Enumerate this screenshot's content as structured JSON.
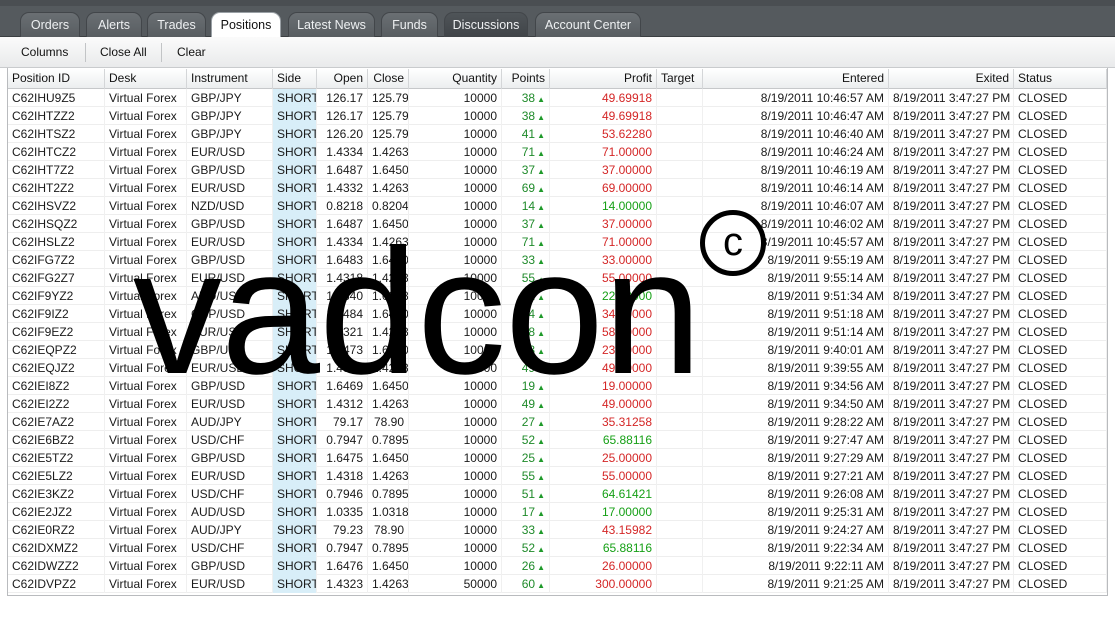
{
  "tabs": [
    {
      "label": "Orders"
    },
    {
      "label": "Alerts"
    },
    {
      "label": "Trades"
    },
    {
      "label": "Positions"
    },
    {
      "label": "Latest News"
    },
    {
      "label": "Funds"
    },
    {
      "label": "Discussions"
    },
    {
      "label": "Account Center"
    }
  ],
  "toolbar": {
    "columns": "Columns",
    "close_all": "Close All",
    "clear": "Clear"
  },
  "columns": [
    "Position ID",
    "Desk",
    "Instrument",
    "Side",
    "Open",
    "Close",
    "Quantity",
    "Points",
    "Profit",
    "Target",
    "Entered",
    "Exited",
    "Status"
  ],
  "rows": [
    [
      "C62IHU9Z5",
      "Virtual Forex",
      "GBP/JPY",
      "SHORT",
      "126.17",
      "125.79",
      "10000",
      "38",
      "49.69918",
      "",
      "8/19/2011 10:46:57 AM",
      "8/19/2011 3:47:27 PM",
      "CLOSED"
    ],
    [
      "C62IHTZZ2",
      "Virtual Forex",
      "GBP/JPY",
      "SHORT",
      "126.17",
      "125.79",
      "10000",
      "38",
      "49.69918",
      "",
      "8/19/2011 10:46:47 AM",
      "8/19/2011 3:47:27 PM",
      "CLOSED"
    ],
    [
      "C62IHTSZ2",
      "Virtual Forex",
      "GBP/JPY",
      "SHORT",
      "126.20",
      "125.79",
      "10000",
      "41",
      "53.62280",
      "",
      "8/19/2011 10:46:40 AM",
      "8/19/2011 3:47:27 PM",
      "CLOSED"
    ],
    [
      "C62IHTCZ2",
      "Virtual Forex",
      "EUR/USD",
      "SHORT",
      "1.4334",
      "1.4263",
      "10000",
      "71",
      "71.00000",
      "",
      "8/19/2011 10:46:24 AM",
      "8/19/2011 3:47:27 PM",
      "CLOSED"
    ],
    [
      "C62IHT7Z2",
      "Virtual Forex",
      "GBP/USD",
      "SHORT",
      "1.6487",
      "1.6450",
      "10000",
      "37",
      "37.00000",
      "",
      "8/19/2011 10:46:19 AM",
      "8/19/2011 3:47:27 PM",
      "CLOSED"
    ],
    [
      "C62IHT2Z2",
      "Virtual Forex",
      "EUR/USD",
      "SHORT",
      "1.4332",
      "1.4263",
      "10000",
      "69",
      "69.00000",
      "",
      "8/19/2011 10:46:14 AM",
      "8/19/2011 3:47:27 PM",
      "CLOSED"
    ],
    [
      "C62IHSVZ2",
      "Virtual Forex",
      "NZD/USD",
      "SHORT",
      "0.8218",
      "0.8204",
      "10000",
      "14",
      "14.00000",
      "",
      "8/19/2011 10:46:07 AM",
      "8/19/2011 3:47:27 PM",
      "CLOSED"
    ],
    [
      "C62IHSQZ2",
      "Virtual Forex",
      "GBP/USD",
      "SHORT",
      "1.6487",
      "1.6450",
      "10000",
      "37",
      "37.00000",
      "",
      "8/19/2011 10:46:02 AM",
      "8/19/2011 3:47:27 PM",
      "CLOSED"
    ],
    [
      "C62IHSLZ2",
      "Virtual Forex",
      "EUR/USD",
      "SHORT",
      "1.4334",
      "1.4263",
      "10000",
      "71",
      "71.00000",
      "",
      "8/19/2011 10:45:57 AM",
      "8/19/2011 3:47:27 PM",
      "CLOSED"
    ],
    [
      "C62IFG7Z2",
      "Virtual Forex",
      "GBP/USD",
      "SHORT",
      "1.6483",
      "1.6450",
      "10000",
      "33",
      "33.00000",
      "",
      "8/19/2011 9:55:19 AM",
      "8/19/2011 3:47:27 PM",
      "CLOSED"
    ],
    [
      "C62IFG2Z7",
      "Virtual Forex",
      "EUR/USD",
      "SHORT",
      "1.4318",
      "1.4263",
      "10000",
      "55",
      "55.00000",
      "",
      "8/19/2011 9:55:14 AM",
      "8/19/2011 3:47:27 PM",
      "CLOSED"
    ],
    [
      "C62IF9YZ2",
      "Virtual Forex",
      "AUD/USD",
      "SHORT",
      "1.0340",
      "1.0318",
      "10000",
      "22",
      "22.00000",
      "",
      "8/19/2011 9:51:34 AM",
      "8/19/2011 3:47:27 PM",
      "CLOSED"
    ],
    [
      "C62IF9IZ2",
      "Virtual Forex",
      "GBP/USD",
      "SHORT",
      "1.6484",
      "1.6450",
      "10000",
      "34",
      "34.00000",
      "",
      "8/19/2011 9:51:18 AM",
      "8/19/2011 3:47:27 PM",
      "CLOSED"
    ],
    [
      "C62IF9EZ2",
      "Virtual Forex",
      "EUR/USD",
      "SHORT",
      "1.4321",
      "1.4263",
      "10000",
      "58",
      "58.00000",
      "",
      "8/19/2011 9:51:14 AM",
      "8/19/2011 3:47:27 PM",
      "CLOSED"
    ],
    [
      "C62IEQPZ2",
      "Virtual Forex",
      "GBP/USD",
      "SHORT",
      "1.6473",
      "1.6450",
      "10000",
      "23",
      "23.00000",
      "",
      "8/19/2011 9:40:01 AM",
      "8/19/2011 3:47:27 PM",
      "CLOSED"
    ],
    [
      "C62IEQJZ2",
      "Virtual Forex",
      "EUR/USD",
      "SHORT",
      "1.4312",
      "1.4263",
      "10000",
      "49",
      "49.00000",
      "",
      "8/19/2011 9:39:55 AM",
      "8/19/2011 3:47:27 PM",
      "CLOSED"
    ],
    [
      "C62IEI8Z2",
      "Virtual Forex",
      "GBP/USD",
      "SHORT",
      "1.6469",
      "1.6450",
      "10000",
      "19",
      "19.00000",
      "",
      "8/19/2011 9:34:56 AM",
      "8/19/2011 3:47:27 PM",
      "CLOSED"
    ],
    [
      "C62IEI2Z2",
      "Virtual Forex",
      "EUR/USD",
      "SHORT",
      "1.4312",
      "1.4263",
      "10000",
      "49",
      "49.00000",
      "",
      "8/19/2011 9:34:50 AM",
      "8/19/2011 3:47:27 PM",
      "CLOSED"
    ],
    [
      "C62IE7AZ2",
      "Virtual Forex",
      "AUD/JPY",
      "SHORT",
      "79.17",
      "78.90",
      "10000",
      "27",
      "35.31258",
      "",
      "8/19/2011 9:28:22 AM",
      "8/19/2011 3:47:27 PM",
      "CLOSED"
    ],
    [
      "C62IE6BZ2",
      "Virtual Forex",
      "USD/CHF",
      "SHORT",
      "0.7947",
      "0.7895",
      "10000",
      "52",
      "65.88116",
      "",
      "8/19/2011 9:27:47 AM",
      "8/19/2011 3:47:27 PM",
      "CLOSED"
    ],
    [
      "C62IE5TZ2",
      "Virtual Forex",
      "GBP/USD",
      "SHORT",
      "1.6475",
      "1.6450",
      "10000",
      "25",
      "25.00000",
      "",
      "8/19/2011 9:27:29 AM",
      "8/19/2011 3:47:27 PM",
      "CLOSED"
    ],
    [
      "C62IE5LZ2",
      "Virtual Forex",
      "EUR/USD",
      "SHORT",
      "1.4318",
      "1.4263",
      "10000",
      "55",
      "55.00000",
      "",
      "8/19/2011 9:27:21 AM",
      "8/19/2011 3:47:27 PM",
      "CLOSED"
    ],
    [
      "C62IE3KZ2",
      "Virtual Forex",
      "USD/CHF",
      "SHORT",
      "0.7946",
      "0.7895",
      "10000",
      "51",
      "64.61421",
      "",
      "8/19/2011 9:26:08 AM",
      "8/19/2011 3:47:27 PM",
      "CLOSED"
    ],
    [
      "C62IE2JZ2",
      "Virtual Forex",
      "AUD/USD",
      "SHORT",
      "1.0335",
      "1.0318",
      "10000",
      "17",
      "17.00000",
      "",
      "8/19/2011 9:25:31 AM",
      "8/19/2011 3:47:27 PM",
      "CLOSED"
    ],
    [
      "C62IE0RZ2",
      "Virtual Forex",
      "AUD/JPY",
      "SHORT",
      "79.23",
      "78.90",
      "10000",
      "33",
      "43.15982",
      "",
      "8/19/2011 9:24:27 AM",
      "8/19/2011 3:47:27 PM",
      "CLOSED"
    ],
    [
      "C62IDXMZ2",
      "Virtual Forex",
      "USD/CHF",
      "SHORT",
      "0.7947",
      "0.7895",
      "10000",
      "52",
      "65.88116",
      "",
      "8/19/2011 9:22:34 AM",
      "8/19/2011 3:47:27 PM",
      "CLOSED"
    ],
    [
      "C62IDWZZ2",
      "Virtual Forex",
      "GBP/USD",
      "SHORT",
      "1.6476",
      "1.6450",
      "10000",
      "26",
      "26.00000",
      "",
      "8/19/2011 9:22:11 AM",
      "8/19/2011 3:47:27 PM",
      "CLOSED"
    ],
    [
      "C62IDVPZ2",
      "Virtual Forex",
      "EUR/USD",
      "SHORT",
      "1.4323",
      "1.4263",
      "50000",
      "60",
      "300.00000",
      "",
      "8/19/2011 9:21:25 AM",
      "8/19/2011 3:47:27 PM",
      "CLOSED"
    ]
  ],
  "profit_green_rows": [
    6,
    11,
    19,
    22,
    23,
    25
  ],
  "watermark": {
    "text": "vadcon",
    "mark": "c"
  },
  "colors": {
    "profit_red": "#d42626",
    "profit_green": "#16a016",
    "points_green": "#1f8a2a",
    "side_bg": "#d8eef8"
  }
}
